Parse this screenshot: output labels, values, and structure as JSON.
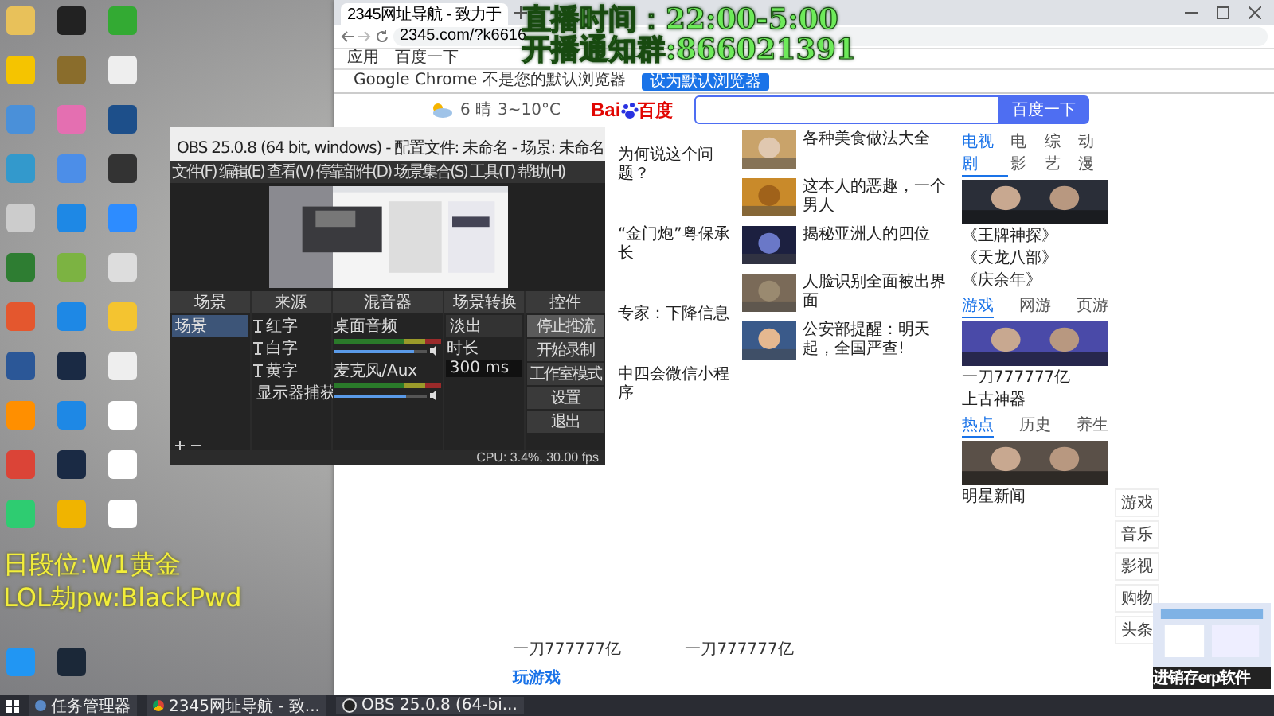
{
  "overlay": {
    "schedule": "直播时间：22:00-5:00",
    "group": "开播通知群:866021391",
    "rank": "日段位:W1黄金",
    "account": "LOL劫pw:BlackPwd"
  },
  "browser": {
    "tab_title": "2345网址导航 - 致力于",
    "url": "2345.com/?k6616",
    "bookmarks": [
      "应用",
      "百度一下"
    ],
    "infobar": {
      "text": "Google Chrome 不是您的默认浏览器",
      "button": "设为默认浏览器"
    },
    "weather": {
      "day": "6 晴",
      "temp": "3~10°C"
    },
    "logo": [
      "Bai",
      "百度"
    ],
    "search_button": "百度一下",
    "left_news": [
      {
        "title": "为何说这个问题？"
      },
      {
        "title": "“金门炮”粤保承长"
      },
      {
        "title": "专家：下降信息"
      },
      {
        "title": "中四会微信小程序"
      }
    ],
    "news": [
      {
        "title": "各种美食做法大全"
      },
      {
        "title": "这本人的恶趣，一个男人"
      },
      {
        "title": "揭秘亚洲人的四位"
      },
      {
        "title": "人脸识别全面被出界面"
      },
      {
        "title": "公安部提醒：明天起，全国严查!"
      }
    ],
    "sidebar_sections": [
      {
        "tabs": [
          {
            "label": "电视剧",
            "selected": true
          },
          {
            "label": "电影",
            "selected": false
          },
          {
            "label": "综艺",
            "selected": false
          },
          {
            "label": "动漫",
            "selected": false
          }
        ],
        "items": [
          "《王牌神探》",
          "《天龙八部》",
          "《庆余年》"
        ]
      },
      {
        "tabs": [
          {
            "label": "游戏",
            "selected": true
          },
          {
            "label": "网游",
            "selected": false
          },
          {
            "label": "页游",
            "selected": false
          }
        ],
        "items": [
          "一刀777777亿",
          "上古神器"
        ]
      },
      {
        "tabs": [
          {
            "label": "热点",
            "selected": true
          },
          {
            "label": "历史",
            "selected": false
          },
          {
            "label": "养生",
            "selected": false
          }
        ],
        "items": [
          "明星新闻"
        ]
      }
    ],
    "bottom_links": [
      "一刀777777亿",
      "一刀777777亿"
    ],
    "games_header": "玩游戏",
    "float_tools": [
      "游戏",
      "音乐",
      "影视",
      "购物",
      "头条"
    ],
    "ad": "进销存erp软件"
  },
  "obs": {
    "title": "OBS 25.0.8 (64 bit, windows) - 配置文件: 未命名 - 场景: 未命名",
    "menu": [
      "文件(F)",
      "编辑(E)",
      "查看(V)",
      "停靠部件(D)",
      "场景集合(S)",
      "工具(T)",
      "帮助(H)"
    ],
    "docks": [
      "场景",
      "来源",
      "混音器",
      "场景转换",
      "控件"
    ],
    "scenes": [
      {
        "name": "场景",
        "selected": true
      }
    ],
    "sources": [
      {
        "name": "红字",
        "kind": "text"
      },
      {
        "name": "白字",
        "kind": "text"
      },
      {
        "name": "黄字",
        "kind": "text"
      },
      {
        "name": "显示器捕获",
        "kind": "display"
      }
    ],
    "mixer": [
      {
        "name": "桌面音频",
        "level": 0.85
      },
      {
        "name": "麦克风/Aux",
        "level": 0.78
      }
    ],
    "transition": {
      "value": "淡出",
      "duration_label": "时长",
      "duration": "300 ms"
    },
    "controls": [
      {
        "label": "停止推流",
        "selected": true
      },
      {
        "label": "开始录制",
        "selected": false
      },
      {
        "label": "工作室模式",
        "selected": false
      },
      {
        "label": "设置",
        "selected": false
      },
      {
        "label": "退出",
        "selected": false
      }
    ],
    "status": "CPU: 3.4%, 30.00 fps"
  },
  "taskbar": [
    {
      "label": "任务管理器",
      "kind": "task"
    },
    {
      "label": "2345网址导航 - 致...",
      "kind": "chrome"
    },
    {
      "label": "OBS 25.0.8 (64-bi...",
      "kind": "obs"
    }
  ]
}
